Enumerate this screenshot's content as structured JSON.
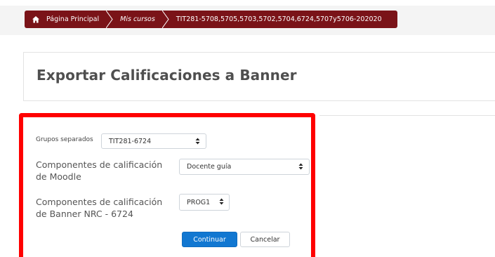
{
  "breadcrumb": {
    "home": "Página Principal",
    "courses": "Mis cursos",
    "current": "TIT281-5708,5705,5703,5702,5704,6724,5707y5706-202020"
  },
  "page": {
    "title": "Exportar Calificaciones a Banner"
  },
  "form": {
    "group_label": "Grupos separados",
    "group_value": "TIT281-6724",
    "moodle_label_line1": "Componentes de calificación",
    "moodle_label_line2": "de Moodle",
    "moodle_value": "Docente guía",
    "banner_label_line1": "Componentes de calificación",
    "banner_label_line2": "de Banner NRC - 6724",
    "banner_value": "PROG1",
    "continue_label": "Continuar",
    "cancel_label": "Cancelar"
  },
  "colors": {
    "breadcrumb_bg": "#7a1318",
    "highlight": "#ff0000",
    "primary_button": "#1177d1"
  },
  "icons": {
    "home": "home-icon",
    "select_caret": "sort-caret-icon"
  }
}
